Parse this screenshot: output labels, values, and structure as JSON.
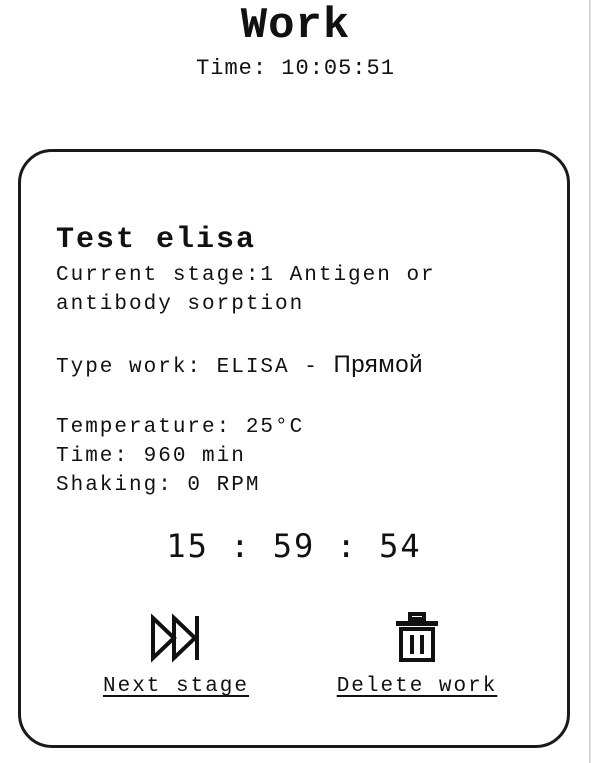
{
  "header": {
    "title": "Work",
    "time": "Time: 10:05:51"
  },
  "work_card": {
    "name": "Test elisa",
    "current_stage": "Current stage:1 Antigen or\nantibody sorption",
    "type_work_prefix": "Type work: ELISA - ",
    "type_work_variant": "Прямой",
    "temperature": "Temperature: 25°C",
    "time": "Time: 960 min",
    "shaking": "Shaking: 0 RPM",
    "countdown": "15 : 59 : 54"
  },
  "actions": {
    "next_stage": {
      "label": "Next stage",
      "icon": "fast-forward-icon"
    },
    "delete_work": {
      "label": "Delete work",
      "icon": "trash-icon"
    }
  }
}
